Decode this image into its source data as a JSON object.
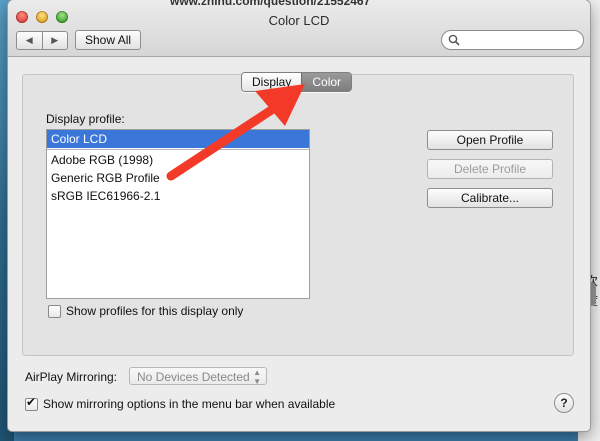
{
  "background": {
    "url_text": "www.zhihu.com/question/21552467",
    "right_chars": [
      "次",
      "度"
    ]
  },
  "window": {
    "title": "Color LCD",
    "nav_back_icon": "◀",
    "nav_forward_icon": "▶",
    "show_all_label": "Show All",
    "search_placeholder": ""
  },
  "tabs": [
    {
      "label": "Display",
      "selected": false
    },
    {
      "label": "Color",
      "selected": true
    }
  ],
  "display_profile": {
    "label": "Display profile:",
    "items": [
      "Color LCD",
      "Adobe RGB (1998)",
      "Generic RGB Profile",
      "sRGB IEC61966-2.1"
    ],
    "selected_item": "Color LCD"
  },
  "show_profiles_checkbox": {
    "label": "Show profiles for this display only",
    "checked": false
  },
  "buttons": {
    "open_profile": "Open Profile",
    "delete_profile": "Delete Profile",
    "calibrate": "Calibrate..."
  },
  "airplay": {
    "label": "AirPlay Mirroring:",
    "value": "No Devices Detected"
  },
  "mirroring_checkbox": {
    "label": "Show mirroring options in the menu bar when available",
    "checked": true
  },
  "help_label": "?",
  "colors": {
    "selection": "#3b77d8",
    "annotation_arrow": "#f33a28",
    "selected_tab": "#8a8a8a"
  }
}
